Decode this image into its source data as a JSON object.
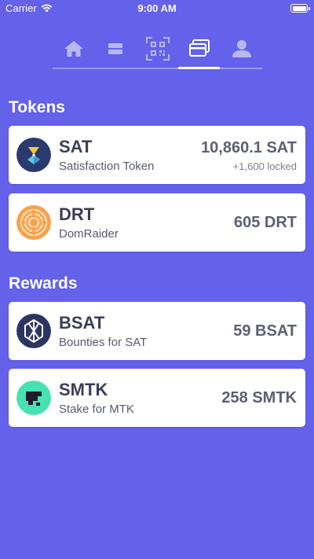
{
  "status_bar": {
    "carrier": "Carrier",
    "time": "9:00 AM"
  },
  "nav": {
    "tabs": [
      {
        "name": "home",
        "icon": "home-icon",
        "active": false
      },
      {
        "name": "list",
        "icon": "list-icon",
        "active": false
      },
      {
        "name": "qr",
        "icon": "qr-code-icon",
        "active": false
      },
      {
        "name": "wallet",
        "icon": "cards-icon",
        "active": true
      },
      {
        "name": "profile",
        "icon": "user-icon",
        "active": false
      }
    ]
  },
  "sections": {
    "tokens_title": "Tokens",
    "rewards_title": "Rewards"
  },
  "tokens": [
    {
      "symbol": "SAT",
      "name": "Satisfaction Token",
      "amount": "10,860.1 SAT",
      "locked": "+1,600 locked",
      "icon": "sat-logo-icon"
    },
    {
      "symbol": "DRT",
      "name": "DomRaider",
      "amount": "605 DRT",
      "icon": "drt-logo-icon"
    }
  ],
  "rewards": [
    {
      "symbol": "BSAT",
      "name": "Bounties for SAT",
      "amount": "59 BSAT",
      "icon": "bsat-logo-icon"
    },
    {
      "symbol": "SMTK",
      "name": "Stake for MTK",
      "amount": "258 SMTK",
      "icon": "smtk-logo-icon"
    }
  ],
  "colors": {
    "background": "#6461ea",
    "card": "#ffffff",
    "text_dark": "#3b3f55",
    "nav_inactive": "#b8b7f3"
  }
}
